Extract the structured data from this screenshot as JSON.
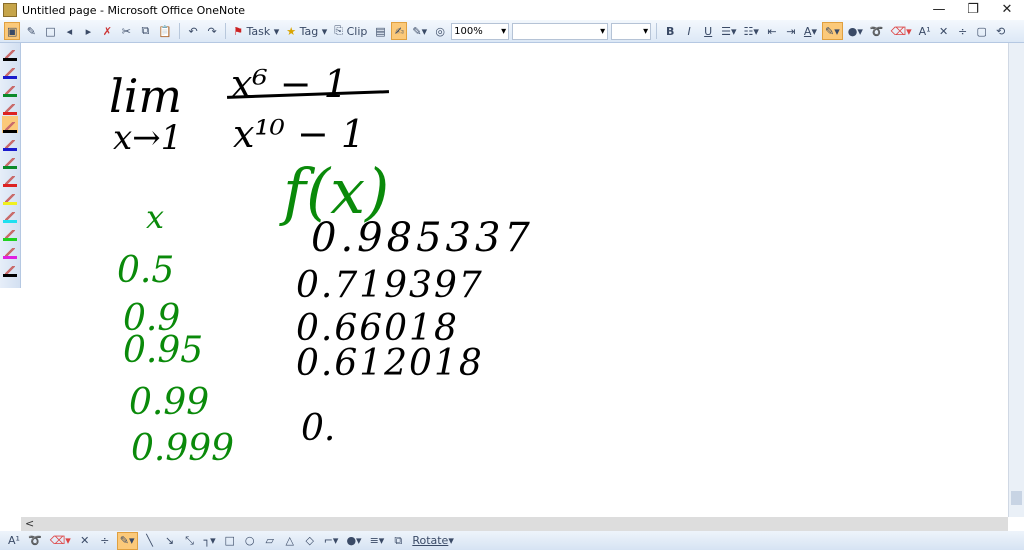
{
  "window": {
    "title": "Untitled page - Microsoft Office OneNote",
    "minimize": "—",
    "restore": "❐",
    "close": "✕"
  },
  "toolbar": {
    "task": "Task",
    "tag": "Tag",
    "clip": "Clip",
    "zoom": "100%",
    "font": "",
    "size": "",
    "bold": "B",
    "italic": "I",
    "underline": "U",
    "font_color": "A",
    "text_size": "A¹"
  },
  "pens": [
    {
      "color": "#000000"
    },
    {
      "color": "#1a1acc"
    },
    {
      "color": "#0a8a2a"
    },
    {
      "color": "#dd2222"
    },
    {
      "color": "#000000",
      "active": true
    },
    {
      "color": "#1a1acc"
    },
    {
      "color": "#0a8a2a"
    },
    {
      "color": "#dd2222"
    },
    {
      "color": "#f0f020"
    },
    {
      "color": "#20e0f0"
    },
    {
      "color": "#20d020"
    },
    {
      "color": "#e020e0"
    },
    {
      "color": "#000000"
    }
  ],
  "ink": {
    "lim": "lim",
    "approach": "x→1",
    "numerator": "x⁶ − 1",
    "denominator": "x¹⁰ − 1",
    "x_header": "x",
    "fx_header": "f(x)",
    "x_values": [
      "0.5",
      "0.9",
      "0.95",
      "0.99",
      "0.999"
    ],
    "f_values": [
      "0.985337",
      "0.719397",
      "0.66018",
      "0.612018",
      "0."
    ]
  },
  "bottombar": {
    "text_size": "A¹",
    "rotate": "Rotate"
  },
  "hscroll": {
    "left": "<"
  }
}
